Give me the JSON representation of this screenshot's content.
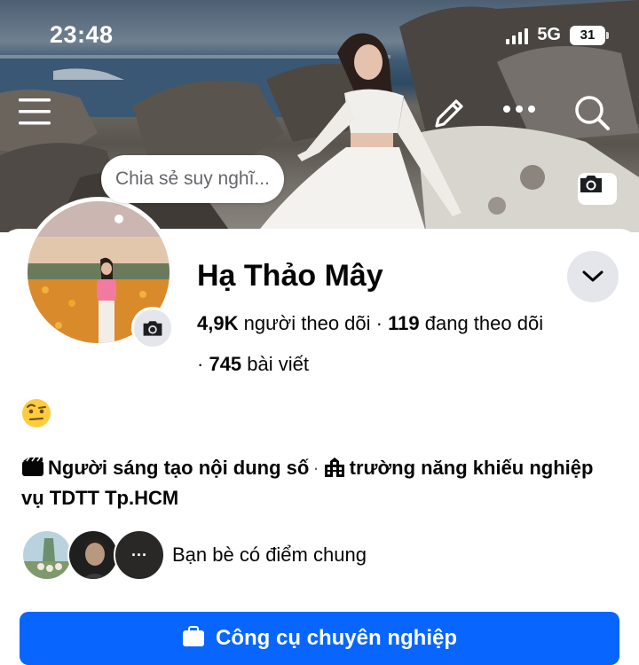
{
  "status_bar": {
    "time": "23:48",
    "network": "5G",
    "battery": "31"
  },
  "cover": {
    "icons": [
      "menu-icon",
      "pencil-icon",
      "more-icon",
      "search-icon",
      "camera-icon"
    ]
  },
  "thought_bubble": {
    "placeholder": "Chia sẻ suy nghĩ..."
  },
  "profile": {
    "name": "Hạ Thảo Mây",
    "followers_count": "4,9K",
    "followers_label": "người theo dõi",
    "following_count": "119",
    "following_label": "đang theo dõi",
    "posts_count": "745",
    "posts_label": "bài viết",
    "separator": "·"
  },
  "bio": {
    "emoji": "🤨",
    "line_role": "Người sáng tạo nội dung số",
    "line_school": "trường năng khiếu nghiệp vụ TDTT Tp.HCM"
  },
  "friends": {
    "label": "Bạn bè có điểm chung",
    "more_glyph": "···"
  },
  "cta": {
    "label": "Công cụ chuyên nghiệp"
  },
  "colors": {
    "accent": "#0866ff",
    "secondary_bg": "#e4e6eb",
    "muted_text": "#65676b"
  }
}
